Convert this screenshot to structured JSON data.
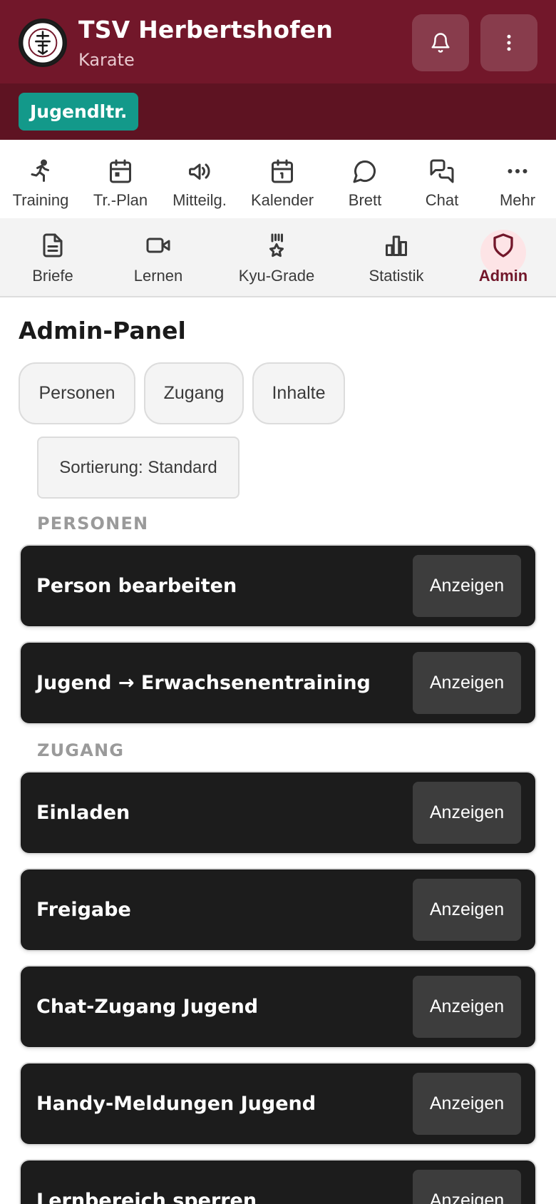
{
  "header": {
    "title": "TSV Herbertshofen",
    "subtitle": "Karate",
    "logo_icon": "club-logo",
    "bell_icon": "bell-icon",
    "more_icon": "more-vertical-icon",
    "accent_color": "#72172a"
  },
  "role": {
    "badge": "Jugendltr.",
    "color": "#13998a"
  },
  "nav_primary": [
    {
      "label": "Training",
      "icon": "running-person-icon"
    },
    {
      "label": "Tr.-Plan",
      "icon": "calendar-icon"
    },
    {
      "label": "Mitteilg.",
      "icon": "megaphone-icon"
    },
    {
      "label": "Kalender",
      "icon": "calendar-icon"
    },
    {
      "label": "Brett",
      "icon": "speech-bubble-icon"
    },
    {
      "label": "Chat",
      "icon": "chat-bubbles-icon"
    },
    {
      "label": "Mehr",
      "icon": "more-horizontal-icon"
    }
  ],
  "nav_secondary": [
    {
      "label": "Briefe",
      "icon": "document-icon"
    },
    {
      "label": "Lernen",
      "icon": "video-icon"
    },
    {
      "label": "Kyu-Grade",
      "icon": "medal-icon"
    },
    {
      "label": "Statistik",
      "icon": "bar-chart-icon"
    },
    {
      "label": "Admin",
      "icon": "shield-icon",
      "active": true
    }
  ],
  "main": {
    "title": "Admin-Panel",
    "filters": [
      "Personen",
      "Zugang",
      "Inhalte"
    ],
    "sort_label": "Sortierung: Standard",
    "sections": [
      {
        "label": "PERSONEN",
        "cards": [
          {
            "title": "Person bearbeiten",
            "action": "Anzeigen"
          },
          {
            "title": "Jugend → Erwachsenentraining",
            "action": "Anzeigen"
          }
        ]
      },
      {
        "label": "ZUGANG",
        "cards": [
          {
            "title": "Einladen",
            "action": "Anzeigen"
          },
          {
            "title": "Freigabe",
            "action": "Anzeigen"
          },
          {
            "title": "Chat-Zugang Jugend",
            "action": "Anzeigen"
          },
          {
            "title": "Handy-Meldungen Jugend",
            "action": "Anzeigen"
          },
          {
            "title": "Lernbereich sperren",
            "action": "Anzeigen"
          }
        ]
      }
    ]
  }
}
